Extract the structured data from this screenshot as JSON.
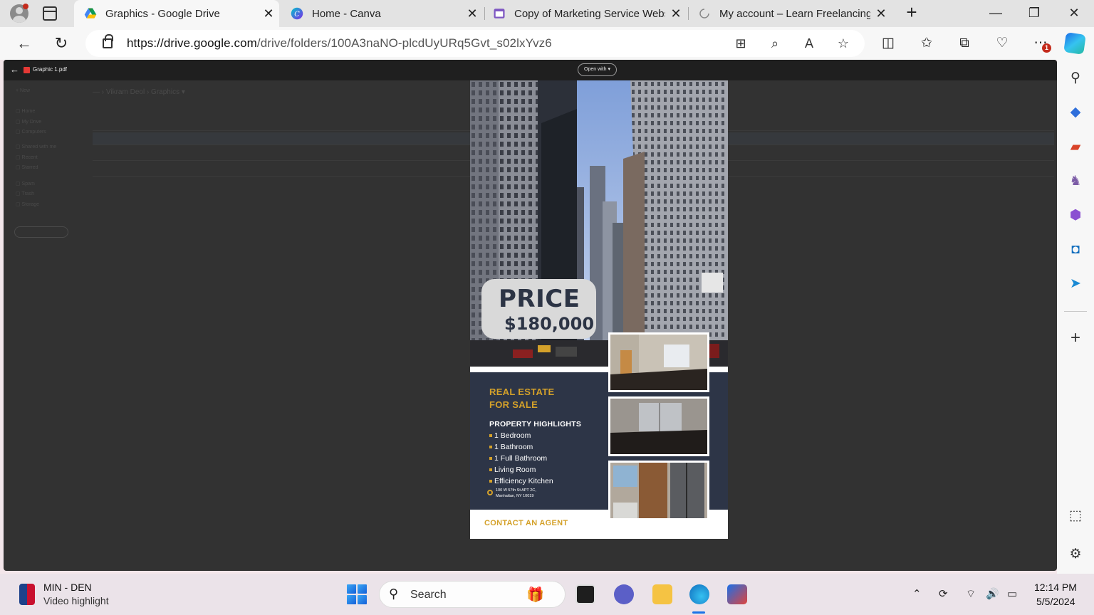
{
  "browser": {
    "tabs": [
      {
        "label": "Graphics - Google Drive",
        "icon": "google-drive-icon",
        "active": true
      },
      {
        "label": "Home - Canva",
        "icon": "canva-icon",
        "active": false
      },
      {
        "label": "Copy of Marketing Service Websi",
        "icon": "google-sites-icon",
        "active": false
      },
      {
        "label": "My account – Learn Freelancing V",
        "icon": "loading-icon",
        "active": false
      }
    ],
    "close_glyph": "✕",
    "new_tab_glyph": "+",
    "url_domain": "https://drive.google.com",
    "url_path": "/drive/folders/100A3naNO-plcdUyURq5Gvt_s02lxYvz6",
    "notification_count": "1"
  },
  "viewer": {
    "file_name": "Graphic 1.pdf",
    "open_with_label": "Open with",
    "back_glyph": "←"
  },
  "flyer": {
    "price_label": "PRICE",
    "price_value": "$180,000",
    "title_line1": "REAL ESTATE",
    "title_line2": "FOR SALE",
    "highlights_title": "PROPERTY HIGHLIGHTS",
    "highlights": [
      "1 Bedroom",
      "1 Bathroom",
      "1 Full Bathroom",
      "Living  Room",
      "Efficiency Kitchen"
    ],
    "address_line1": "100 W 57th St APT 2C,",
    "address_line2": "Manhattan, NY 10019",
    "contact": "CONTACT AN AGENT",
    "colors": {
      "navy": "#2d3547",
      "gold": "#d4a12a",
      "price_box": "#d9d9d9"
    }
  },
  "taskbar": {
    "widget_title": "MIN - DEN",
    "widget_subtitle": "Video highlight",
    "search_placeholder": "Search",
    "time": "12:14 PM",
    "date": "5/5/2024"
  }
}
